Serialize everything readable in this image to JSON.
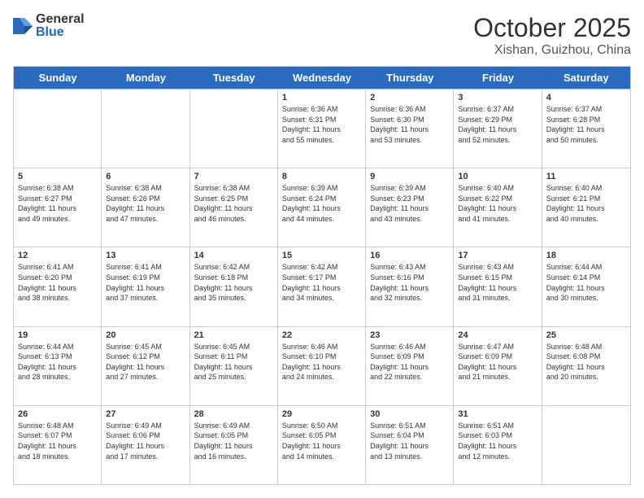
{
  "logo": {
    "general": "General",
    "blue": "Blue"
  },
  "header": {
    "month": "October 2025",
    "location": "Xishan, Guizhou, China"
  },
  "weekdays": [
    "Sunday",
    "Monday",
    "Tuesday",
    "Wednesday",
    "Thursday",
    "Friday",
    "Saturday"
  ],
  "weeks": [
    [
      {
        "day": "",
        "info": ""
      },
      {
        "day": "",
        "info": ""
      },
      {
        "day": "",
        "info": ""
      },
      {
        "day": "1",
        "info": "Sunrise: 6:36 AM\nSunset: 6:31 PM\nDaylight: 11 hours\nand 55 minutes."
      },
      {
        "day": "2",
        "info": "Sunrise: 6:36 AM\nSunset: 6:30 PM\nDaylight: 11 hours\nand 53 minutes."
      },
      {
        "day": "3",
        "info": "Sunrise: 6:37 AM\nSunset: 6:29 PM\nDaylight: 11 hours\nand 52 minutes."
      },
      {
        "day": "4",
        "info": "Sunrise: 6:37 AM\nSunset: 6:28 PM\nDaylight: 11 hours\nand 50 minutes."
      }
    ],
    [
      {
        "day": "5",
        "info": "Sunrise: 6:38 AM\nSunset: 6:27 PM\nDaylight: 11 hours\nand 49 minutes."
      },
      {
        "day": "6",
        "info": "Sunrise: 6:38 AM\nSunset: 6:26 PM\nDaylight: 11 hours\nand 47 minutes."
      },
      {
        "day": "7",
        "info": "Sunrise: 6:38 AM\nSunset: 6:25 PM\nDaylight: 11 hours\nand 46 minutes."
      },
      {
        "day": "8",
        "info": "Sunrise: 6:39 AM\nSunset: 6:24 PM\nDaylight: 11 hours\nand 44 minutes."
      },
      {
        "day": "9",
        "info": "Sunrise: 6:39 AM\nSunset: 6:23 PM\nDaylight: 11 hours\nand 43 minutes."
      },
      {
        "day": "10",
        "info": "Sunrise: 6:40 AM\nSunset: 6:22 PM\nDaylight: 11 hours\nand 41 minutes."
      },
      {
        "day": "11",
        "info": "Sunrise: 6:40 AM\nSunset: 6:21 PM\nDaylight: 11 hours\nand 40 minutes."
      }
    ],
    [
      {
        "day": "12",
        "info": "Sunrise: 6:41 AM\nSunset: 6:20 PM\nDaylight: 11 hours\nand 38 minutes."
      },
      {
        "day": "13",
        "info": "Sunrise: 6:41 AM\nSunset: 6:19 PM\nDaylight: 11 hours\nand 37 minutes."
      },
      {
        "day": "14",
        "info": "Sunrise: 6:42 AM\nSunset: 6:18 PM\nDaylight: 11 hours\nand 35 minutes."
      },
      {
        "day": "15",
        "info": "Sunrise: 6:42 AM\nSunset: 6:17 PM\nDaylight: 11 hours\nand 34 minutes."
      },
      {
        "day": "16",
        "info": "Sunrise: 6:43 AM\nSunset: 6:16 PM\nDaylight: 11 hours\nand 32 minutes."
      },
      {
        "day": "17",
        "info": "Sunrise: 6:43 AM\nSunset: 6:15 PM\nDaylight: 11 hours\nand 31 minutes."
      },
      {
        "day": "18",
        "info": "Sunrise: 6:44 AM\nSunset: 6:14 PM\nDaylight: 11 hours\nand 30 minutes."
      }
    ],
    [
      {
        "day": "19",
        "info": "Sunrise: 6:44 AM\nSunset: 6:13 PM\nDaylight: 11 hours\nand 28 minutes."
      },
      {
        "day": "20",
        "info": "Sunrise: 6:45 AM\nSunset: 6:12 PM\nDaylight: 11 hours\nand 27 minutes."
      },
      {
        "day": "21",
        "info": "Sunrise: 6:45 AM\nSunset: 6:11 PM\nDaylight: 11 hours\nand 25 minutes."
      },
      {
        "day": "22",
        "info": "Sunrise: 6:46 AM\nSunset: 6:10 PM\nDaylight: 11 hours\nand 24 minutes."
      },
      {
        "day": "23",
        "info": "Sunrise: 6:46 AM\nSunset: 6:09 PM\nDaylight: 11 hours\nand 22 minutes."
      },
      {
        "day": "24",
        "info": "Sunrise: 6:47 AM\nSunset: 6:09 PM\nDaylight: 11 hours\nand 21 minutes."
      },
      {
        "day": "25",
        "info": "Sunrise: 6:48 AM\nSunset: 6:08 PM\nDaylight: 11 hours\nand 20 minutes."
      }
    ],
    [
      {
        "day": "26",
        "info": "Sunrise: 6:48 AM\nSunset: 6:07 PM\nDaylight: 11 hours\nand 18 minutes."
      },
      {
        "day": "27",
        "info": "Sunrise: 6:49 AM\nSunset: 6:06 PM\nDaylight: 11 hours\nand 17 minutes."
      },
      {
        "day": "28",
        "info": "Sunrise: 6:49 AM\nSunset: 6:05 PM\nDaylight: 11 hours\nand 16 minutes."
      },
      {
        "day": "29",
        "info": "Sunrise: 6:50 AM\nSunset: 6:05 PM\nDaylight: 11 hours\nand 14 minutes."
      },
      {
        "day": "30",
        "info": "Sunrise: 6:51 AM\nSunset: 6:04 PM\nDaylight: 11 hours\nand 13 minutes."
      },
      {
        "day": "31",
        "info": "Sunrise: 6:51 AM\nSunset: 6:03 PM\nDaylight: 11 hours\nand 12 minutes."
      },
      {
        "day": "",
        "info": ""
      }
    ]
  ]
}
